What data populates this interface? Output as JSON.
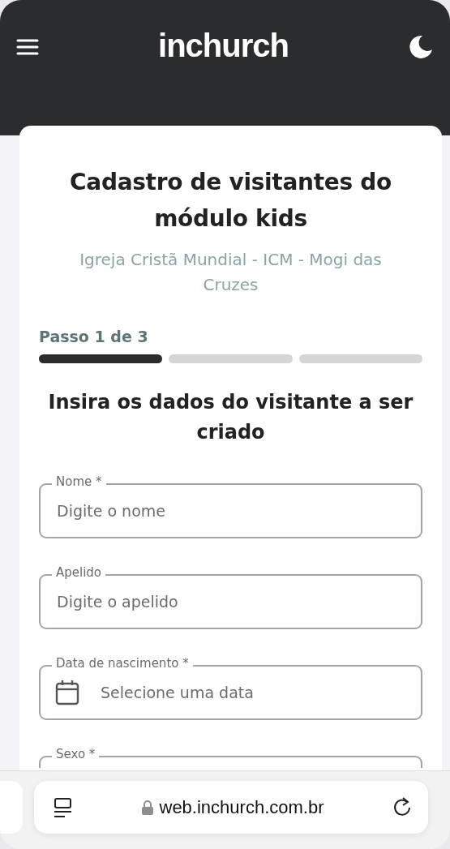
{
  "header": {
    "logo": "inchurch"
  },
  "card": {
    "title": "Cadastro de visitantes do módulo kids",
    "subtitle": "Igreja Cristã Mundial - ICM - Mogi das Cruzes"
  },
  "stepper": {
    "label": "Passo 1 de 3",
    "steps": [
      {
        "selected": true
      },
      {
        "selected": false
      },
      {
        "selected": false
      }
    ]
  },
  "form": {
    "heading": "Insira os dados do visitante a ser criado",
    "fields": [
      {
        "kind": "text",
        "label": "Nome *",
        "placeholder": "Digite o nome"
      },
      {
        "kind": "text",
        "label": "Apelido",
        "placeholder": "Digite o apelido"
      },
      {
        "kind": "date",
        "label": "Data de nascimento *",
        "placeholder": "Selecione uma data"
      },
      {
        "kind": "select",
        "label": "Sexo *"
      }
    ]
  },
  "browser_bar": {
    "url": "web.inchurch.com.br"
  }
}
